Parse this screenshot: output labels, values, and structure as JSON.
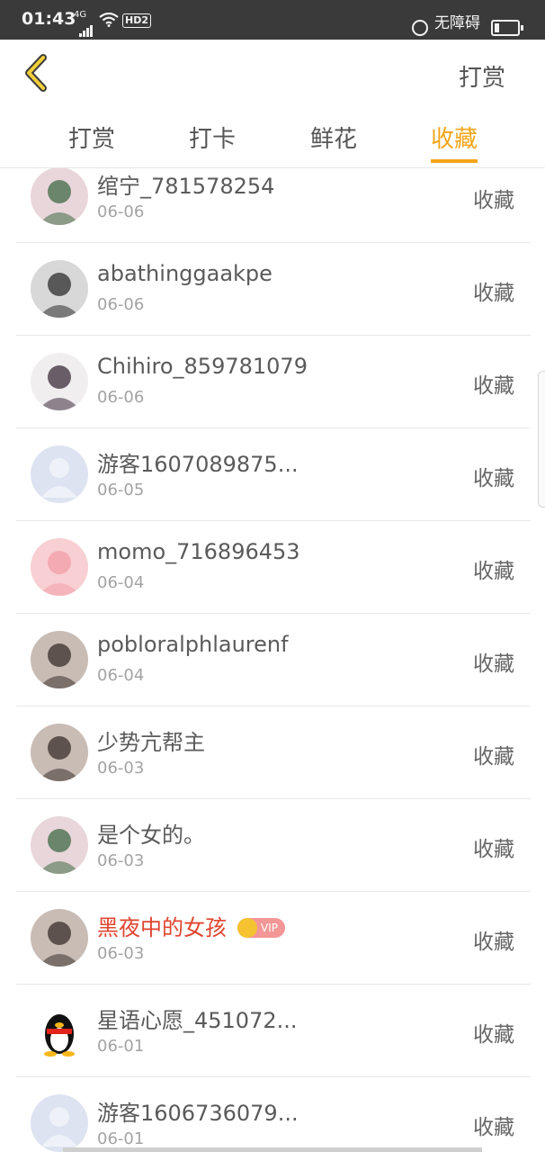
{
  "status_bar": {
    "time": "01:43",
    "network": "4G",
    "hd": "HD2",
    "accessibility": "无障碍"
  },
  "header": {
    "action_label": "打赏"
  },
  "tabs": [
    {
      "label": "打赏",
      "active": false
    },
    {
      "label": "打卡",
      "active": false
    },
    {
      "label": "鲜花",
      "active": false
    },
    {
      "label": "收藏",
      "active": true
    }
  ],
  "accent_color": "#f3a518",
  "list": [
    {
      "name": "绾宁_781578254",
      "date": "06-06",
      "tag": "收藏",
      "avatar": "anime-girl-avatar"
    },
    {
      "name": "abathinggaakpe",
      "date": "06-06",
      "tag": "收藏",
      "avatar": "street-sign-avatar"
    },
    {
      "name": "Chihiro_859781079",
      "date": "06-06",
      "tag": "收藏",
      "avatar": "anime-boy-avatar"
    },
    {
      "name": "游客1607089875...",
      "date": "06-05",
      "tag": "收藏",
      "avatar": "default-user-avatar"
    },
    {
      "name": "momo_716896453",
      "date": "06-04",
      "tag": "收藏",
      "avatar": "pink-cartoon-avatar"
    },
    {
      "name": "pobloralphlaurenf",
      "date": "06-04",
      "tag": "收藏",
      "avatar": "girl-photo-avatar"
    },
    {
      "name": "少势亢帮主",
      "date": "06-03",
      "tag": "收藏",
      "avatar": "girl-photo-avatar"
    },
    {
      "name": "是个女的。",
      "date": "06-03",
      "tag": "收藏",
      "avatar": "anime-girl-avatar"
    },
    {
      "name": "黑夜中的女孩",
      "date": "06-03",
      "tag": "收藏",
      "avatar": "girl-photo-avatar",
      "vip": true,
      "vip_label": "VIP"
    },
    {
      "name": "星语心愿_451072...",
      "date": "06-01",
      "tag": "收藏",
      "avatar": "qq-penguin-avatar"
    },
    {
      "name": "游客1606736079...",
      "date": "06-01",
      "tag": "收藏",
      "avatar": "default-user-avatar"
    }
  ]
}
